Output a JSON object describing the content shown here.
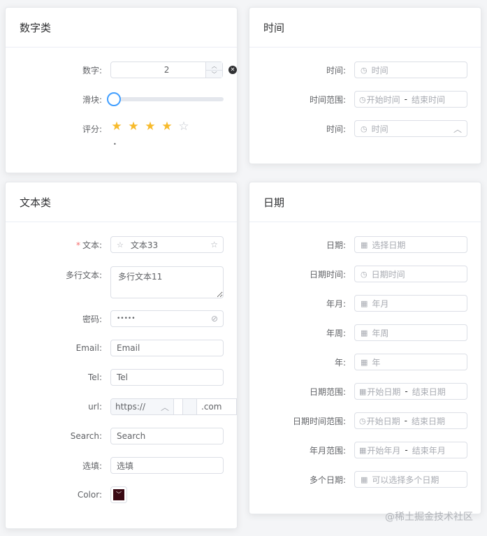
{
  "number_card": {
    "title": "数字类",
    "number_label": "数字:",
    "number_value": "2",
    "slider_label": "滑块:",
    "slider_value": 0,
    "rate_label": "评分:",
    "rate_value": 4,
    "rate_max": 5,
    "rate_text": "•"
  },
  "time_card": {
    "title": "时间",
    "rows": [
      {
        "label": "时间:",
        "placeholder": "时间"
      },
      {
        "label": "时间范围:",
        "start": "开始时间",
        "end": "结束时间"
      },
      {
        "label": "时间:",
        "placeholder": "时间"
      }
    ]
  },
  "text_card": {
    "title": "文本类",
    "text_label": "文本:",
    "text_value": "文本33",
    "textarea_label": "多行文本:",
    "textarea_value": "多行文本11",
    "password_label": "密码:",
    "password_value": "•••••",
    "email_label": "Email:",
    "email_value": "Email",
    "tel_label": "Tel:",
    "tel_value": "Tel",
    "url_label": "url:",
    "url_prefix": "https://",
    "url_suffix": ".com",
    "search_label": "Search:",
    "search_value": "Search",
    "select_label": "选填:",
    "select_value": "选填",
    "color_label": "Color:",
    "color_value": "#3a0a14"
  },
  "date_card": {
    "title": "日期",
    "rows": [
      {
        "label": "日期:",
        "placeholder": "选择日期",
        "icon": "calendar"
      },
      {
        "label": "日期时间:",
        "placeholder": "日期时间",
        "icon": "clock"
      },
      {
        "label": "年月:",
        "placeholder": "年月",
        "icon": "calendar"
      },
      {
        "label": "年周:",
        "placeholder": "年周",
        "icon": "calendar"
      },
      {
        "label": "年:",
        "placeholder": "年",
        "icon": "calendar"
      },
      {
        "label": "日期范围:",
        "start": "开始日期",
        "end": "结束日期",
        "icon": "calendar"
      },
      {
        "label": "日期时间范围:",
        "start": "开始日期",
        "end": "结束日期",
        "icon": "clock"
      },
      {
        "label": "年月范围:",
        "start": "开始年月",
        "end": "结束年月",
        "icon": "calendar"
      },
      {
        "label": "多个日期:",
        "placeholder": "可以选择多个日期",
        "icon": "calendar"
      }
    ]
  },
  "watermark": "@稀土掘金技术社区"
}
